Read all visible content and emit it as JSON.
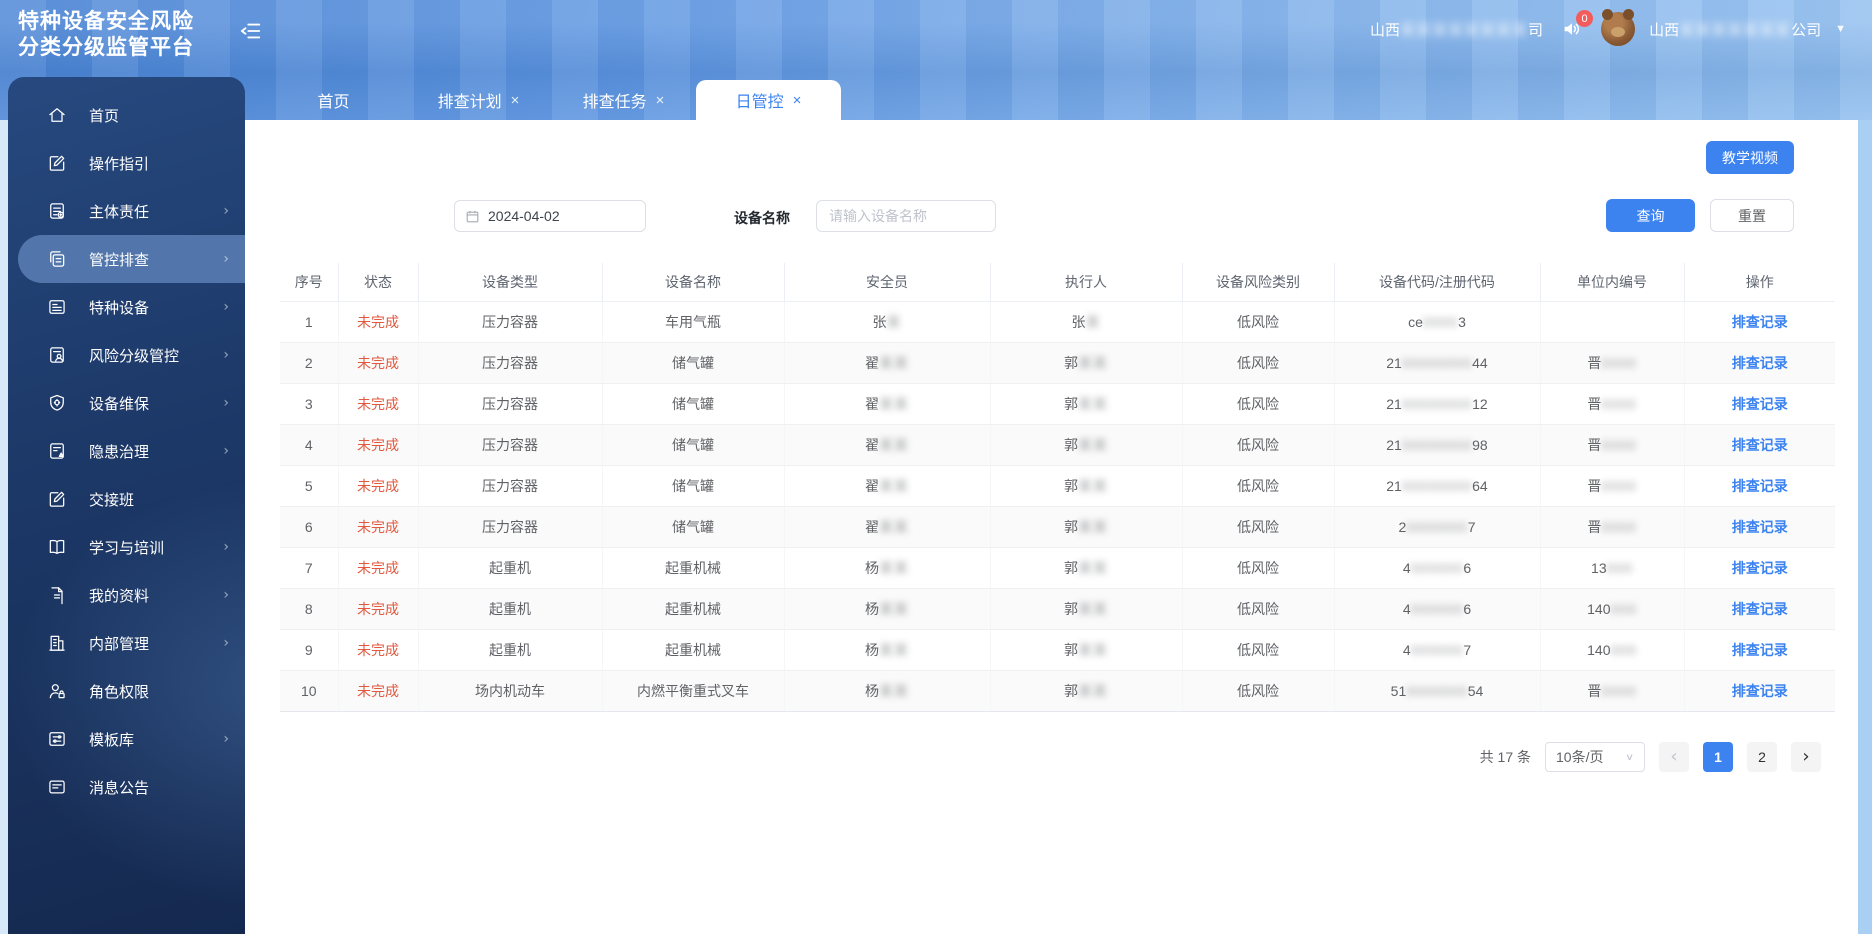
{
  "header": {
    "title_line1": "特种设备安全风险",
    "title_line2": "分类分级监管平台",
    "company_left": {
      "prefix": "山西",
      "masked": "某某某某某某某某",
      "suffix": "司"
    },
    "notification_count": "0",
    "company_right": {
      "prefix": "山西",
      "masked": "某某某某某某某",
      "suffix": "公司"
    }
  },
  "tabs": [
    {
      "label": "首页",
      "closable": false,
      "active": false
    },
    {
      "label": "排查计划",
      "closable": true,
      "active": false
    },
    {
      "label": "排查任务",
      "closable": true,
      "active": false
    },
    {
      "label": "日管控",
      "closable": true,
      "active": true
    }
  ],
  "sidebar": {
    "items": [
      {
        "label": "首页",
        "icon": "home",
        "expandable": false,
        "active": false
      },
      {
        "label": "操作指引",
        "icon": "edit",
        "expandable": false,
        "active": false
      },
      {
        "label": "主体责任",
        "icon": "doc",
        "expandable": true,
        "active": false
      },
      {
        "label": "管控排查",
        "icon": "copy",
        "expandable": true,
        "active": true
      },
      {
        "label": "特种设备",
        "icon": "card",
        "expandable": true,
        "active": false
      },
      {
        "label": "风险分级管控",
        "icon": "doc-person",
        "expandable": true,
        "active": false
      },
      {
        "label": "设备维保",
        "icon": "shield",
        "expandable": true,
        "active": false
      },
      {
        "label": "隐患治理",
        "icon": "doc-warning",
        "expandable": true,
        "active": false
      },
      {
        "label": "交接班",
        "icon": "edit",
        "expandable": false,
        "active": false
      },
      {
        "label": "学习与培训",
        "icon": "book",
        "expandable": true,
        "active": false
      },
      {
        "label": "我的资料",
        "icon": "file",
        "expandable": true,
        "active": false
      },
      {
        "label": "内部管理",
        "icon": "building",
        "expandable": true,
        "active": false
      },
      {
        "label": "角色权限",
        "icon": "person-lock",
        "expandable": false,
        "active": false
      },
      {
        "label": "模板库",
        "icon": "template",
        "expandable": true,
        "active": false
      },
      {
        "label": "消息公告",
        "icon": "notice",
        "expandable": false,
        "active": false
      }
    ]
  },
  "toolbar": {
    "video_label": "教学视频",
    "search_label": "查询",
    "reset_label": "重置"
  },
  "filters": {
    "date_value": "2024-04-02",
    "device_label": "设备名称",
    "device_placeholder": "请输入设备名称"
  },
  "table": {
    "columns": [
      "序号",
      "状态",
      "设备类型",
      "设备名称",
      "安全员",
      "执行人",
      "设备风险类别",
      "设备代码/注册代码",
      "单位内编号",
      "操作"
    ],
    "action_label": "排查记录",
    "rows": [
      {
        "no": "1",
        "status": "未完成",
        "type": "压力容器",
        "name": "车用气瓶",
        "safety_prefix": "张",
        "safety_masked": "某",
        "exec_prefix": "张",
        "exec_masked": "某",
        "risk": "低风险",
        "code_prefix": "ce",
        "code_masked": "0000",
        "code_suffix": "3",
        "unit_prefix": "",
        "unit_masked": ""
      },
      {
        "no": "2",
        "status": "未完成",
        "type": "压力容器",
        "name": "储气罐",
        "safety_prefix": "翟",
        "safety_masked": "某某",
        "exec_prefix": "郭",
        "exec_masked": "某某",
        "risk": "低风险",
        "code_prefix": "21",
        "code_masked": "00000000",
        "code_suffix": "44",
        "unit_prefix": "晋",
        "unit_masked": "0000"
      },
      {
        "no": "3",
        "status": "未完成",
        "type": "压力容器",
        "name": "储气罐",
        "safety_prefix": "翟",
        "safety_masked": "某某",
        "exec_prefix": "郭",
        "exec_masked": "某某",
        "risk": "低风险",
        "code_prefix": "21",
        "code_masked": "00000000",
        "code_suffix": "12",
        "unit_prefix": "晋",
        "unit_masked": "0000"
      },
      {
        "no": "4",
        "status": "未完成",
        "type": "压力容器",
        "name": "储气罐",
        "safety_prefix": "翟",
        "safety_masked": "某某",
        "exec_prefix": "郭",
        "exec_masked": "某某",
        "risk": "低风险",
        "code_prefix": "21",
        "code_masked": "00000000",
        "code_suffix": "98",
        "unit_prefix": "晋",
        "unit_masked": "0000"
      },
      {
        "no": "5",
        "status": "未完成",
        "type": "压力容器",
        "name": "储气罐",
        "safety_prefix": "翟",
        "safety_masked": "某某",
        "exec_prefix": "郭",
        "exec_masked": "某某",
        "risk": "低风险",
        "code_prefix": "21",
        "code_masked": "00000000",
        "code_suffix": "64",
        "unit_prefix": "晋",
        "unit_masked": "0000"
      },
      {
        "no": "6",
        "status": "未完成",
        "type": "压力容器",
        "name": "储气罐",
        "safety_prefix": "翟",
        "safety_masked": "某某",
        "exec_prefix": "郭",
        "exec_masked": "某某",
        "risk": "低风险",
        "code_prefix": "2",
        "code_masked": "0000000",
        "code_suffix": "7",
        "unit_prefix": "晋",
        "unit_masked": "0000"
      },
      {
        "no": "7",
        "status": "未完成",
        "type": "起重机",
        "name": "起重机械",
        "safety_prefix": "杨",
        "safety_masked": "某某",
        "exec_prefix": "郭",
        "exec_masked": "某某",
        "risk": "低风险",
        "code_prefix": "4",
        "code_masked": "000000",
        "code_suffix": "6",
        "unit_prefix": "13",
        "unit_masked": "000"
      },
      {
        "no": "8",
        "status": "未完成",
        "type": "起重机",
        "name": "起重机械",
        "safety_prefix": "杨",
        "safety_masked": "某某",
        "exec_prefix": "郭",
        "exec_masked": "某某",
        "risk": "低风险",
        "code_prefix": "4",
        "code_masked": "000000",
        "code_suffix": "6",
        "unit_prefix": "140",
        "unit_masked": "000"
      },
      {
        "no": "9",
        "status": "未完成",
        "type": "起重机",
        "name": "起重机械",
        "safety_prefix": "杨",
        "safety_masked": "某某",
        "exec_prefix": "郭",
        "exec_masked": "某某",
        "risk": "低风险",
        "code_prefix": "4",
        "code_masked": "000000",
        "code_suffix": "7",
        "unit_prefix": "140",
        "unit_masked": "000"
      },
      {
        "no": "10",
        "status": "未完成",
        "type": "场内机动车",
        "name": "内燃平衡重式叉车",
        "safety_prefix": "杨",
        "safety_masked": "某某",
        "exec_prefix": "郭",
        "exec_masked": "某某",
        "risk": "低风险",
        "code_prefix": "51",
        "code_masked": "0000000",
        "code_suffix": "54",
        "unit_prefix": "晋",
        "unit_masked": "0000"
      }
    ]
  },
  "pagination": {
    "total_label": "共 17 条",
    "page_size_label": "10条/页",
    "pages": [
      "1",
      "2"
    ],
    "current": "1",
    "prev": "‹",
    "next": "›"
  }
}
